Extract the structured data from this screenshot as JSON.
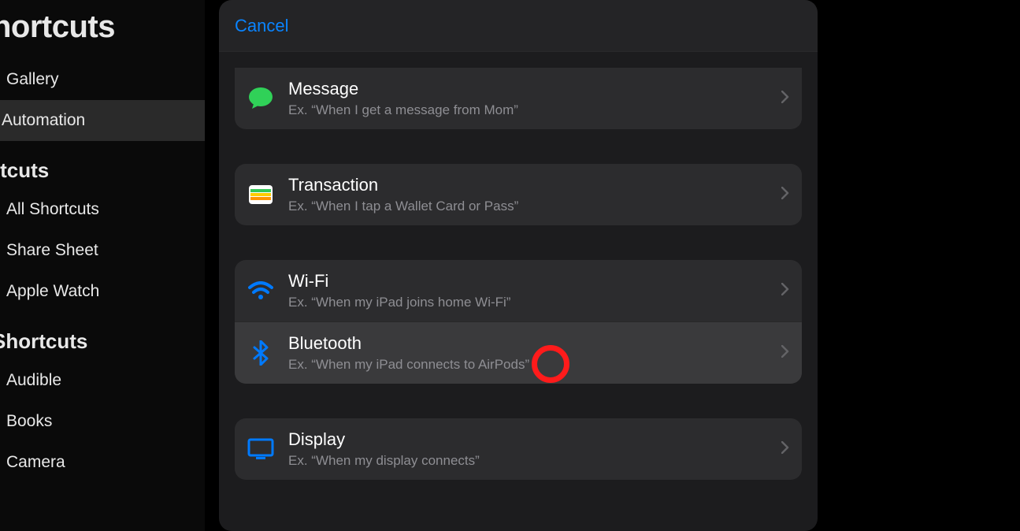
{
  "sidebar": {
    "title": "hortcuts",
    "items": [
      {
        "label": "Gallery",
        "selected": false
      },
      {
        "label": "Automation",
        "selected": true
      }
    ],
    "heading1": "rtcuts",
    "group1": [
      {
        "label": "All Shortcuts"
      },
      {
        "label": "Share Sheet"
      },
      {
        "label": "Apple Watch"
      }
    ],
    "heading2": "Shortcuts",
    "group2": [
      {
        "label": "Audible"
      },
      {
        "label": "Books"
      },
      {
        "label": "Camera"
      }
    ]
  },
  "modal": {
    "cancel": "Cancel",
    "groups": [
      {
        "rows": [
          {
            "icon": "message",
            "title": "Message",
            "sub": "Ex. “When I get a message from Mom”",
            "hl": false
          }
        ]
      },
      {
        "rows": [
          {
            "icon": "wallet",
            "title": "Transaction",
            "sub": "Ex. “When I tap a Wallet Card or Pass”",
            "hl": false
          }
        ]
      },
      {
        "rows": [
          {
            "icon": "wifi",
            "title": "Wi-Fi",
            "sub": "Ex. “When my iPad joins home Wi-Fi”",
            "hl": false
          },
          {
            "icon": "bluetooth",
            "title": "Bluetooth",
            "sub": "Ex. “When my iPad connects to AirPods”",
            "hl": true
          }
        ]
      },
      {
        "rows": [
          {
            "icon": "display",
            "title": "Display",
            "sub": "Ex. “When my display connects”",
            "hl": false
          }
        ]
      }
    ]
  }
}
